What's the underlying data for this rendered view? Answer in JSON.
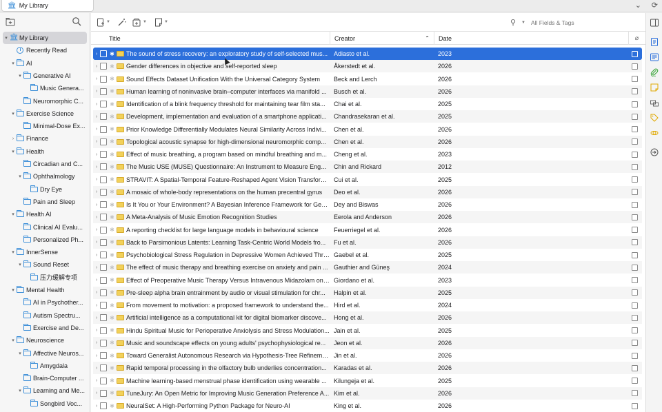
{
  "tab": {
    "title": "My Library"
  },
  "search": {
    "placeholder": "All Fields & Tags"
  },
  "columns": {
    "title": "Title",
    "creator": "Creator",
    "date": "Date"
  },
  "collections": [
    {
      "label": "My Library",
      "indent": 0,
      "twisty": "▾",
      "kind": "library",
      "selected": true
    },
    {
      "label": "Recently Read",
      "indent": 1,
      "twisty": "",
      "kind": "clock"
    },
    {
      "label": "AI",
      "indent": 1,
      "twisty": "▾",
      "kind": "folder"
    },
    {
      "label": "Generative AI",
      "indent": 2,
      "twisty": "▾",
      "kind": "folder"
    },
    {
      "label": "Music Genera...",
      "indent": 3,
      "twisty": "",
      "kind": "folder"
    },
    {
      "label": "Neuromorphic C...",
      "indent": 2,
      "twisty": "",
      "kind": "folder"
    },
    {
      "label": "Exercise Science",
      "indent": 1,
      "twisty": "▾",
      "kind": "folder"
    },
    {
      "label": "Minimal-Dose Ex...",
      "indent": 2,
      "twisty": "",
      "kind": "folder"
    },
    {
      "label": "Finance",
      "indent": 1,
      "twisty": "›",
      "kind": "folder"
    },
    {
      "label": "Health",
      "indent": 1,
      "twisty": "▾",
      "kind": "folder"
    },
    {
      "label": "Circadian and C...",
      "indent": 2,
      "twisty": "",
      "kind": "folder"
    },
    {
      "label": "Ophthalmology",
      "indent": 2,
      "twisty": "▾",
      "kind": "folder"
    },
    {
      "label": "Dry Eye",
      "indent": 3,
      "twisty": "",
      "kind": "folder"
    },
    {
      "label": "Pain and Sleep",
      "indent": 2,
      "twisty": "",
      "kind": "folder"
    },
    {
      "label": "Health AI",
      "indent": 1,
      "twisty": "▾",
      "kind": "folder"
    },
    {
      "label": "Clinical AI Evalu...",
      "indent": 2,
      "twisty": "",
      "kind": "folder"
    },
    {
      "label": "Personalized Ph...",
      "indent": 2,
      "twisty": "",
      "kind": "folder"
    },
    {
      "label": "InnerSense",
      "indent": 1,
      "twisty": "▾",
      "kind": "folder"
    },
    {
      "label": "Sound Reset",
      "indent": 2,
      "twisty": "▾",
      "kind": "folder"
    },
    {
      "label": "压力缓解专项",
      "indent": 3,
      "twisty": "",
      "kind": "folder"
    },
    {
      "label": "Mental Health",
      "indent": 1,
      "twisty": "▾",
      "kind": "folder"
    },
    {
      "label": "AI in Psychother...",
      "indent": 2,
      "twisty": "",
      "kind": "folder"
    },
    {
      "label": "Autism Spectru...",
      "indent": 2,
      "twisty": "",
      "kind": "folder"
    },
    {
      "label": "Exercise and De...",
      "indent": 2,
      "twisty": "",
      "kind": "folder"
    },
    {
      "label": "Neuroscience",
      "indent": 1,
      "twisty": "▾",
      "kind": "folder"
    },
    {
      "label": "Affective Neuros...",
      "indent": 2,
      "twisty": "▾",
      "kind": "folder"
    },
    {
      "label": "Amygdala",
      "indent": 3,
      "twisty": "",
      "kind": "folder"
    },
    {
      "label": "Brain-Computer ...",
      "indent": 2,
      "twisty": "",
      "kind": "folder"
    },
    {
      "label": "Learning and Me...",
      "indent": 2,
      "twisty": "▾",
      "kind": "folder"
    },
    {
      "label": "Songbird Voc...",
      "indent": 3,
      "twisty": "",
      "kind": "folder"
    }
  ],
  "items": [
    {
      "title": "The sound of stress recovery: an exploratory study of self-selected mus...",
      "creator": "Adiasto et al.",
      "date": "2023",
      "selected": true
    },
    {
      "title": "Gender differences in objective and self-reported sleep",
      "creator": "Åkerstedt et al.",
      "date": "2026"
    },
    {
      "title": "Sound Effects Dataset Unification With the Universal Category System",
      "creator": "Beck and Lerch",
      "date": "2026"
    },
    {
      "title": "Human learning of noninvasive brain–computer interfaces via manifold ...",
      "creator": "Busch et al.",
      "date": "2026"
    },
    {
      "title": "Identification of a blink frequency threshold for maintaining tear film sta...",
      "creator": "Chai et al.",
      "date": "2025"
    },
    {
      "title": "Development, implementation and evaluation of a smartphone applicati...",
      "creator": "Chandrasekaran et al.",
      "date": "2025"
    },
    {
      "title": "Prior Knowledge Differentially Modulates Neural Similarity Across Indivi...",
      "creator": "Chen et al.",
      "date": "2026"
    },
    {
      "title": "Topological acoustic synapse for high-dimensional neuromorphic comp...",
      "creator": "Chen et al.",
      "date": "2026"
    },
    {
      "title": "Effect of music breathing, a program based on mindful breathing and m...",
      "creator": "Cheng et al.",
      "date": "2023"
    },
    {
      "title": "The Music USE (MUSE) Questionnaire: An Instrument to Measure Engag...",
      "creator": "Chin and Rickard",
      "date": "2012"
    },
    {
      "title": "STRAVIT: A Spatial-Temporal Feature-Reshaped Agent Vision Transform...",
      "creator": "Cui et al.",
      "date": "2025"
    },
    {
      "title": "A mosaic of whole-body representations on the human precentral gyrus",
      "creator": "Deo et al.",
      "date": "2026"
    },
    {
      "title": "Is It You or Your Environment? A Bayesian Inference Framework for Gen...",
      "creator": "Dey and Biswas",
      "date": "2026"
    },
    {
      "title": "A Meta-Analysis of Music Emotion Recognition Studies",
      "creator": "Eerola and Anderson",
      "date": "2026"
    },
    {
      "title": "A reporting checklist for large language models in behavioural science",
      "creator": "Feuerriegel et al.",
      "date": "2026"
    },
    {
      "title": "Back to Parsimonious Latents: Learning Task-Centric World Models fro...",
      "creator": "Fu et al.",
      "date": "2026"
    },
    {
      "title": "Psychobiological Stress Regulation in Depressive Women Achieved Thro...",
      "creator": "Gaebel et al.",
      "date": "2025"
    },
    {
      "title": "The effect of music therapy and breathing exercise on anxiety and pain ...",
      "creator": "Gauthier and Güneş",
      "date": "2024"
    },
    {
      "title": "Effect of Preoperative Music Therapy Versus Intravenous Midazolam on ...",
      "creator": "Giordano et al.",
      "date": "2023"
    },
    {
      "title": "Pre-sleep alpha brain entrainment by audio or visual stimulation for chr...",
      "creator": "Halpin et al.",
      "date": "2025"
    },
    {
      "title": "From movement to motivation: a proposed framework to understand the...",
      "creator": "Hird et al.",
      "date": "2024"
    },
    {
      "title": "Artificial intelligence as a computational kit for digital biomarker discove...",
      "creator": "Hong et al.",
      "date": "2026"
    },
    {
      "title": "Hindu Spiritual Music for Perioperative Anxiolysis and Stress Modulation...",
      "creator": "Jain et al.",
      "date": "2025"
    },
    {
      "title": "Music and soundscape effects on young adults' psychophysiological re...",
      "creator": "Jeon et al.",
      "date": "2026"
    },
    {
      "title": "Toward Generalist Autonomous Research via Hypothesis-Tree Refinement",
      "creator": "Jin et al.",
      "date": "2026"
    },
    {
      "title": "Rapid temporal processing in the olfactory bulb underlies concentration...",
      "creator": "Karadas et al.",
      "date": "2026"
    },
    {
      "title": "Machine learning-based menstrual phase identification using wearable ...",
      "creator": "Kilungeja et al.",
      "date": "2025"
    },
    {
      "title": "TuneJury: An Open Metric for Improving Music Generation Preference A...",
      "creator": "Kim et al.",
      "date": "2026"
    },
    {
      "title": "NeuralSet: A High-Performing Python Package for Neuro-AI",
      "creator": "King et al.",
      "date": "2026"
    }
  ]
}
